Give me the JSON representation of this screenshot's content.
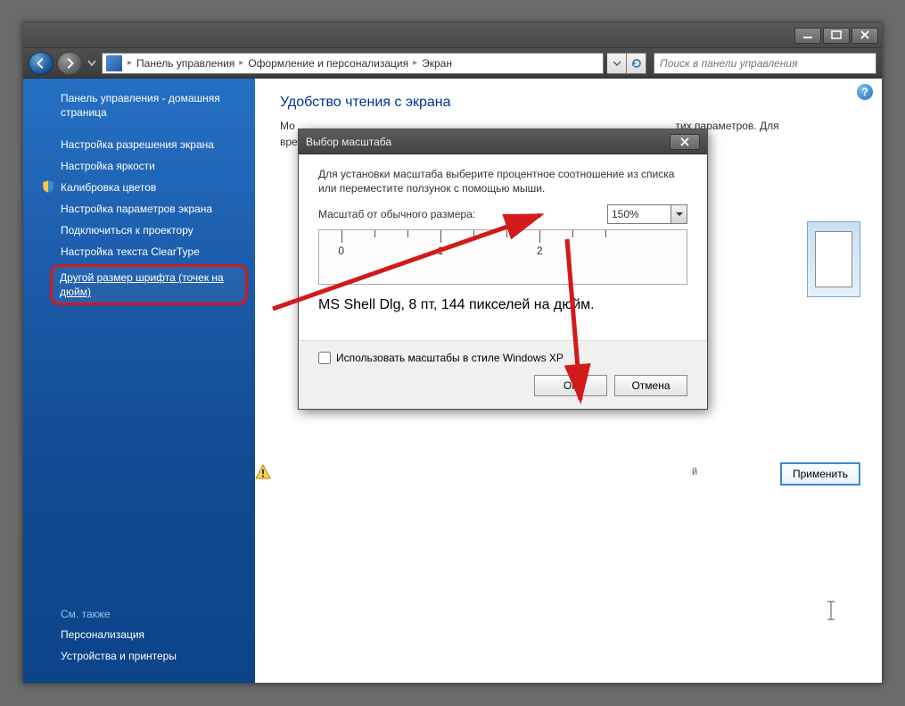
{
  "titlebar": {},
  "nav": {
    "breadcrumbs": [
      "Панель управления",
      "Оформление и персонализация",
      "Экран"
    ],
    "search_placeholder": "Поиск в панели управления"
  },
  "sidebar": {
    "home": "Панель управления - домашняя страница",
    "items": [
      "Настройка разрешения экрана",
      "Настройка яркости",
      "Калибровка цветов",
      "Настройка параметров экрана",
      "Подключиться к проектору",
      "Настройка текста ClearType",
      "Другой размер шрифта (точек на дюйм)"
    ],
    "see_also_label": "См. также",
    "see_also": [
      "Персонализация",
      "Устройства и принтеры"
    ]
  },
  "content": {
    "heading": "Удобство чтения с экрана",
    "desc_prefix": "Мо",
    "desc_suffix_1": "тих параметров. Для",
    "desc_line2": "вре",
    "small_suffix": "й",
    "apply_label": "Применить",
    "help_tooltip": "?"
  },
  "dialog": {
    "title": "Выбор масштаба",
    "instructions": "Для установки масштаба выберите процентное соотношение из списка или переместите ползунок с помощью мыши.",
    "scale_label": "Масштаб от обычного размера:",
    "scale_value": "150%",
    "ruler_ticks": [
      "0",
      "1",
      "2"
    ],
    "sample_text": "MS Shell Dlg, 8 пт, 144 пикселей на дюйм.",
    "checkbox_label": "Использовать масштабы в стиле Windows XP",
    "ok_label": "ОК",
    "cancel_label": "Отмена"
  }
}
